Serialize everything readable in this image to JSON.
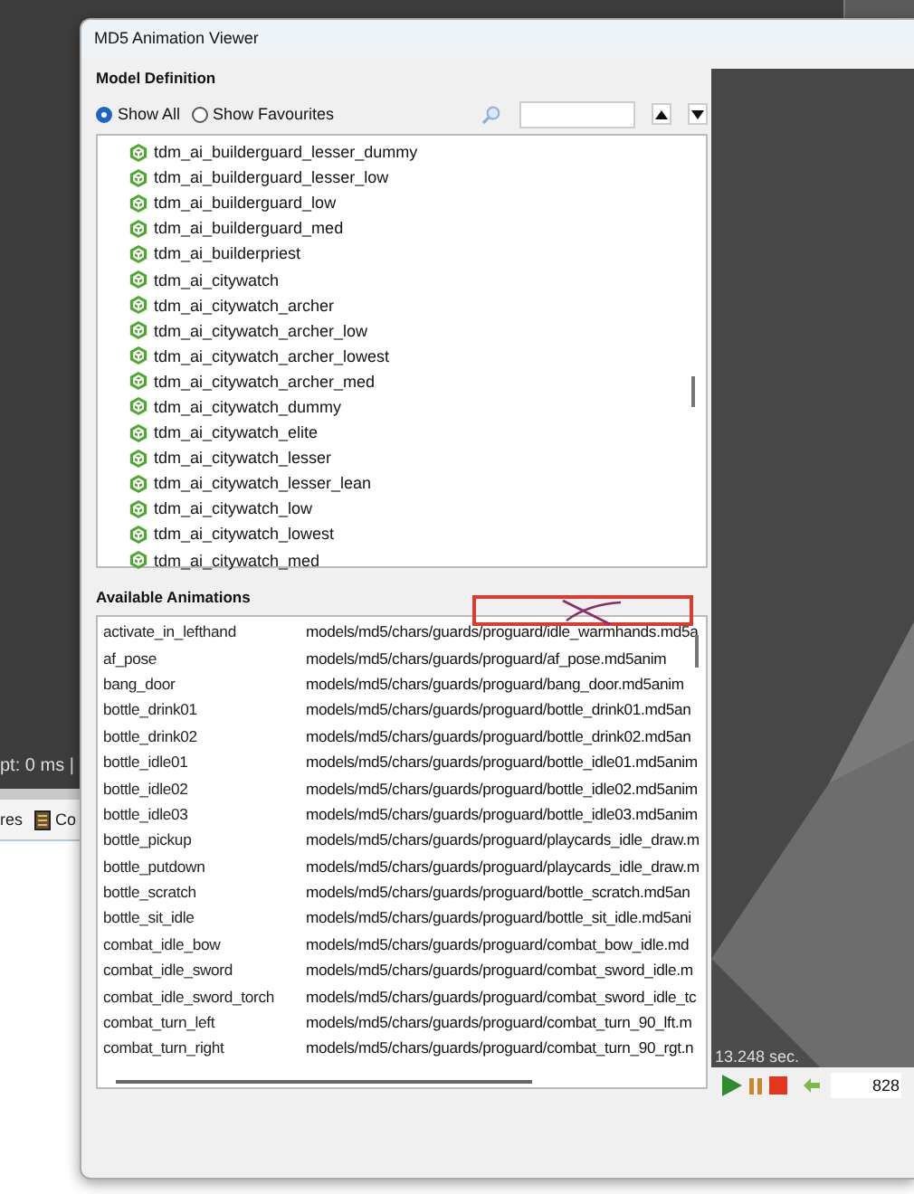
{
  "background": {
    "status_text": "pt: 0 ms |",
    "tabs": [
      {
        "label": "res"
      },
      {
        "label": "Co"
      }
    ]
  },
  "window": {
    "title": "MD5 Animation Viewer"
  },
  "model_definition": {
    "title": "Model Definition",
    "filters": [
      {
        "label": "Show All",
        "selected": true
      },
      {
        "label": "Show Favourites",
        "selected": false
      }
    ],
    "items": [
      {
        "label": "tdm_ai_builderguard_lesser_dummy"
      },
      {
        "label": "tdm_ai_builderguard_lesser_low"
      },
      {
        "label": "tdm_ai_builderguard_low"
      },
      {
        "label": "tdm_ai_builderguard_med"
      },
      {
        "label": "tdm_ai_builderpriest"
      },
      {
        "label": "tdm_ai_citywatch"
      },
      {
        "label": "tdm_ai_citywatch_archer"
      },
      {
        "label": "tdm_ai_citywatch_archer_low"
      },
      {
        "label": "tdm_ai_citywatch_archer_lowest"
      },
      {
        "label": "tdm_ai_citywatch_archer_med"
      },
      {
        "label": "tdm_ai_citywatch_dummy"
      },
      {
        "label": "tdm_ai_citywatch_elite"
      },
      {
        "label": "tdm_ai_citywatch_lesser"
      },
      {
        "label": "tdm_ai_citywatch_lesser_lean"
      },
      {
        "label": "tdm_ai_citywatch_low"
      },
      {
        "label": "tdm_ai_citywatch_lowest"
      },
      {
        "label": "tdm_ai_citywatch_med"
      }
    ]
  },
  "animations": {
    "title": "Available Animations",
    "rows": [
      {
        "name": "activate_in_lefthand",
        "file": "models/md5/chars/guards/proguard/idle_warmhands.md5a"
      },
      {
        "name": "af_pose",
        "file": "models/md5/chars/guards/proguard/af_pose.md5anim"
      },
      {
        "name": "bang_door",
        "file": "models/md5/chars/guards/proguard/bang_door.md5anim"
      },
      {
        "name": "bottle_drink01",
        "file": "models/md5/chars/guards/proguard/bottle_drink01.md5an"
      },
      {
        "name": "bottle_drink02",
        "file": "models/md5/chars/guards/proguard/bottle_drink02.md5an"
      },
      {
        "name": "bottle_idle01",
        "file": "models/md5/chars/guards/proguard/bottle_idle01.md5anim"
      },
      {
        "name": "bottle_idle02",
        "file": "models/md5/chars/guards/proguard/bottle_idle02.md5anim"
      },
      {
        "name": "bottle_idle03",
        "file": "models/md5/chars/guards/proguard/bottle_idle03.md5anim"
      },
      {
        "name": "bottle_pickup",
        "file": "models/md5/chars/guards/proguard/playcards_idle_draw.m"
      },
      {
        "name": "bottle_putdown",
        "file": "models/md5/chars/guards/proguard/playcards_idle_draw.m"
      },
      {
        "name": "bottle_scratch",
        "file": "models/md5/chars/guards/proguard/bottle_scratch.md5an"
      },
      {
        "name": "bottle_sit_idle",
        "file": "models/md5/chars/guards/proguard/bottle_sit_idle.md5ani"
      },
      {
        "name": "combat_idle_bow",
        "file": "models/md5/chars/guards/proguard/combat_bow_idle.md"
      },
      {
        "name": "combat_idle_sword",
        "file": "models/md5/chars/guards/proguard/combat_sword_idle.m"
      },
      {
        "name": "combat_idle_sword_torch",
        "file": "models/md5/chars/guards/proguard/combat_sword_idle_tc"
      },
      {
        "name": "combat_turn_left",
        "file": "models/md5/chars/guards/proguard/combat_turn_90_lft.m"
      },
      {
        "name": "combat_turn_right",
        "file": "models/md5/chars/guards/proguard/combat_turn_90_rgt.n"
      }
    ]
  },
  "viewport": {
    "time": "13.248 sec."
  },
  "playback": {
    "frame": "828"
  }
}
